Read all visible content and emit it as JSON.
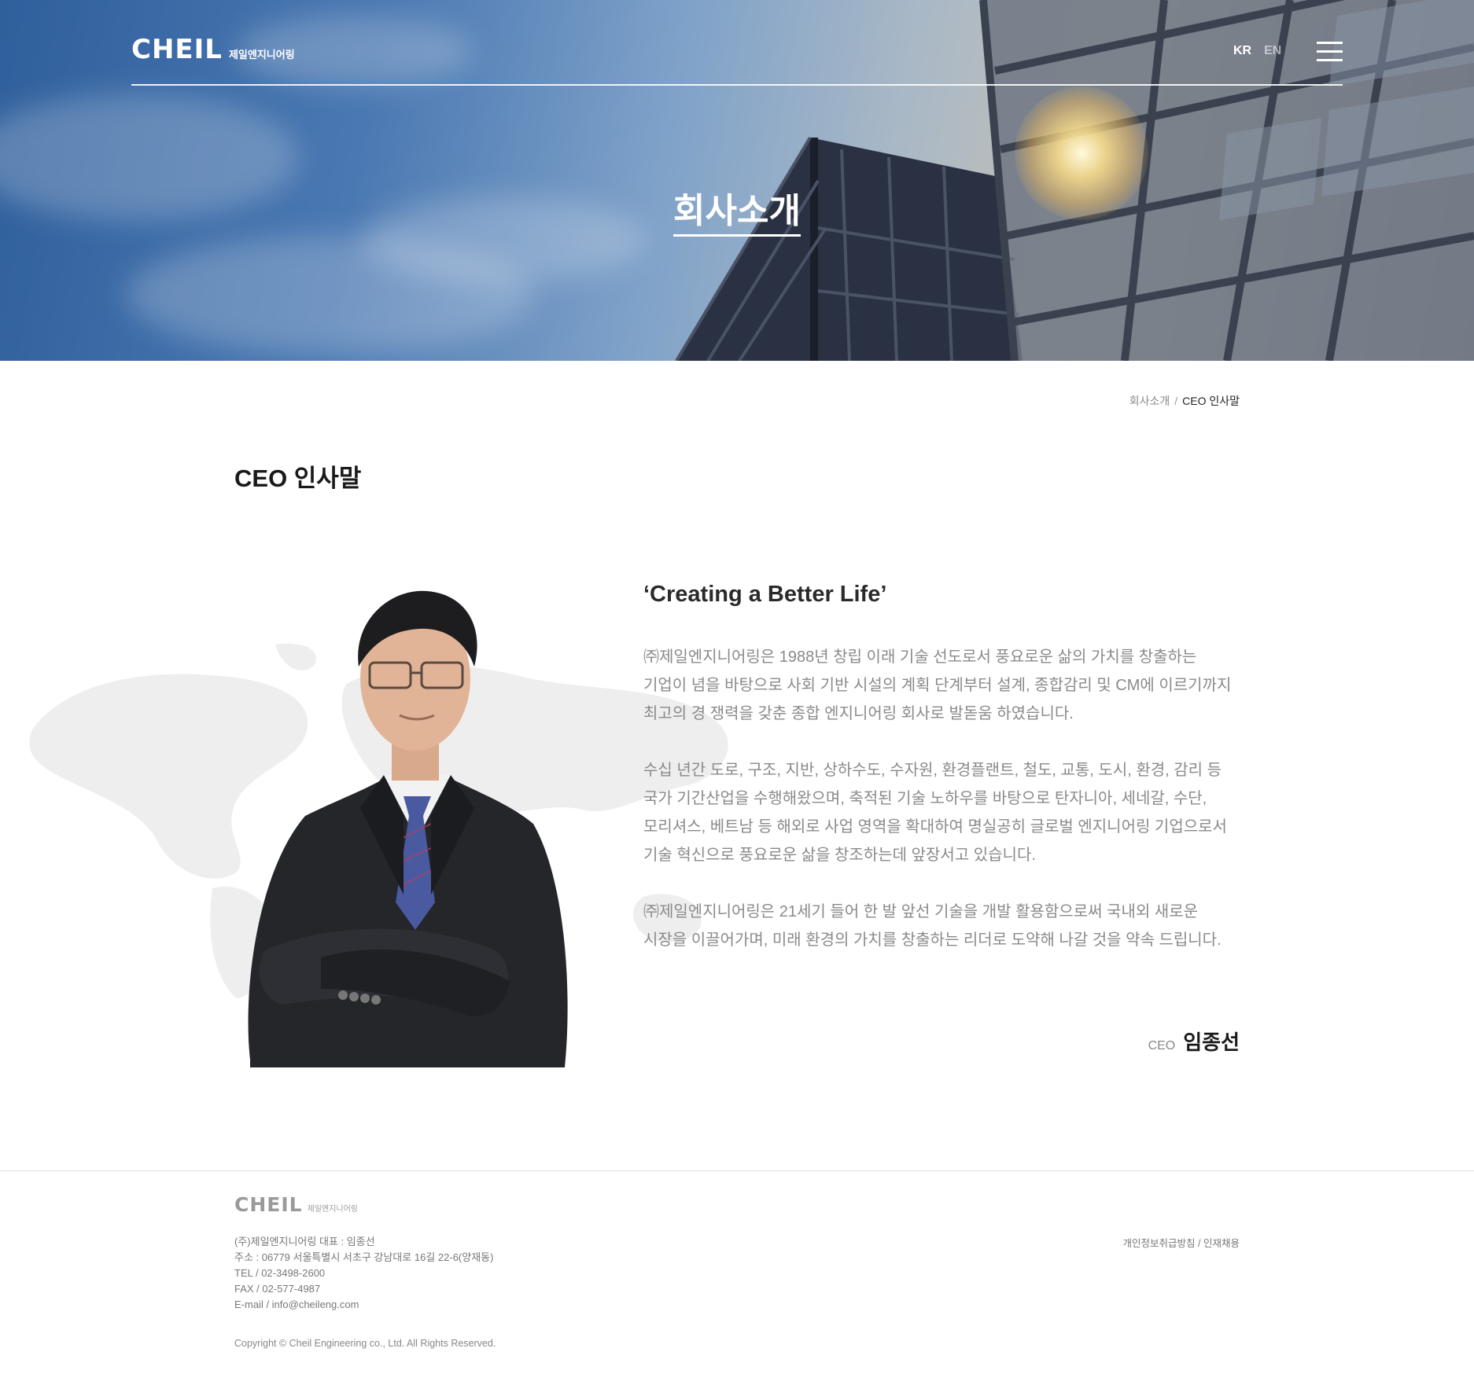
{
  "header": {
    "logo_mark": "CHEIL",
    "logo_sub": "제일엔지니어링",
    "lang_kr": "KR",
    "lang_en": "EN",
    "menu_icon": "hamburger-menu-icon"
  },
  "hero": {
    "title": "회사소개"
  },
  "breadcrumb": {
    "parent": "회사소개",
    "separator": "/",
    "current": "CEO 인사말"
  },
  "page": {
    "title": "CEO 인사말"
  },
  "ceo": {
    "quote": "‘Creating a Better Life’",
    "paragraph1": [
      "㈜제일엔지니어링은 1988년 창립 이래 기술 선도로서 풍요로운 삶의 가치를 창출하는",
      "기업이 념을 바탕으로 사회 기반 시설의 계획 단계부터 설계, 종합감리 및 CM에 이르기까지",
      "최고의 경 쟁력을 갖춘 종합 엔지니어링 회사로 발돋움 하였습니다."
    ],
    "paragraph2": [
      "수십 년간 도로, 구조, 지반, 상하수도, 수자원, 환경플랜트, 철도, 교통, 도시, 환경, 감리 등",
      "국가 기간산업을 수행해왔으며, 축적된 기술 노하우를 바탕으로 탄자니아, 세네갈, 수단,",
      "모리셔스, 베트남 등 해외로 사업 영역을 확대하여 명실공히 글로벌 엔지니어링 기업으로서",
      "기술 혁신으로 풍요로운 삶을 창조하는데 앞장서고 있습니다."
    ],
    "paragraph3": [
      "㈜제일엔지니어링은 21세기 들어 한 발 앞선 기술을 개발 활용함으로써 국내외 새로운",
      "시장을 이끌어가며, 미래 환경의 가치를 창출하는 리더로 도약해 나갈 것을 약속 드립니다."
    ],
    "sign_label": "CEO",
    "sign_name": "임종선"
  },
  "footer": {
    "logo_mark": "CHEIL",
    "logo_sub": "제일엔지니어링",
    "company": "(주)제일엔지니어링 대표 : 임종선",
    "address": "주소 : 06779 서울특별시 서초구 강남대로 16길 22-6(양재동)",
    "tel": "TEL / 02-3498-2600",
    "fax": "FAX / 02-577-4987",
    "email": "E-mail / info@cheileng.com",
    "link_privacy": "개인정보취급방침",
    "link_sep": " / ",
    "link_recruit": "인재채용",
    "copyright": "Copyright © Cheil Engineering co., Ltd. All Rights Reserved."
  }
}
